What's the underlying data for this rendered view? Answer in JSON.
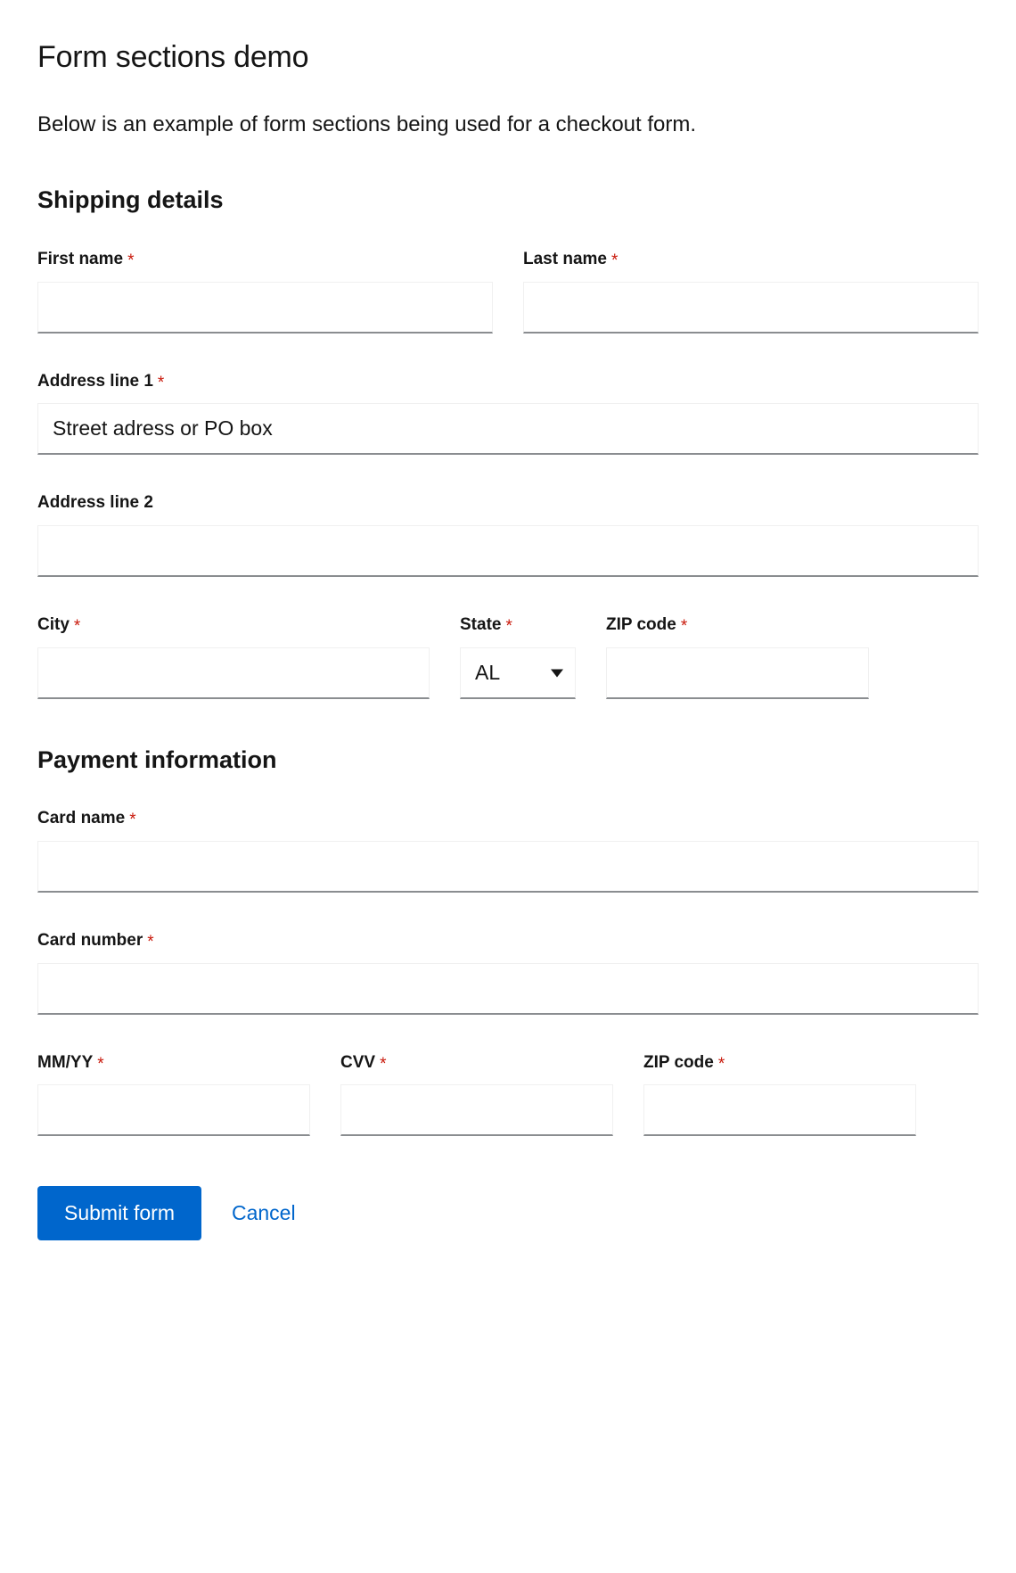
{
  "header": {
    "title": "Form sections demo",
    "description": "Below is an example of form sections being used for a checkout form."
  },
  "colors": {
    "primary": "#0066CC",
    "required_asterisk": "#C9190B",
    "text": "#151515",
    "input_border_bottom": "#8A8D90",
    "input_border": "#F0F0F0"
  },
  "required_marker": "*",
  "sections": [
    {
      "title": "Shipping details",
      "fields": {
        "first_name": {
          "label": "First name",
          "value": "",
          "placeholder": ""
        },
        "last_name": {
          "label": "Last name",
          "value": "",
          "placeholder": ""
        },
        "address_line_1": {
          "label": "Address line 1",
          "value": "",
          "placeholder": "Street adress or PO box"
        },
        "address_line_2": {
          "label": "Address line 2",
          "value": "",
          "placeholder": ""
        },
        "city": {
          "label": "City",
          "value": "",
          "placeholder": ""
        },
        "state": {
          "label": "State",
          "value": "AL",
          "options": [
            "AL"
          ]
        },
        "zip_code": {
          "label": "ZIP code",
          "value": "",
          "placeholder": ""
        }
      }
    },
    {
      "title": "Payment information",
      "fields": {
        "card_name": {
          "label": "Card name",
          "value": "",
          "placeholder": ""
        },
        "card_number": {
          "label": "Card number",
          "value": "",
          "placeholder": ""
        },
        "expiry": {
          "label": "MM/YY",
          "value": "",
          "placeholder": ""
        },
        "cvv": {
          "label": "CVV",
          "value": "",
          "placeholder": ""
        },
        "zip_code": {
          "label": "ZIP code",
          "value": "",
          "placeholder": ""
        }
      }
    }
  ],
  "actions": {
    "submit_label": "Submit form",
    "cancel_label": "Cancel"
  },
  "icons": {
    "dropdown_caret": "chevron-down-icon"
  }
}
